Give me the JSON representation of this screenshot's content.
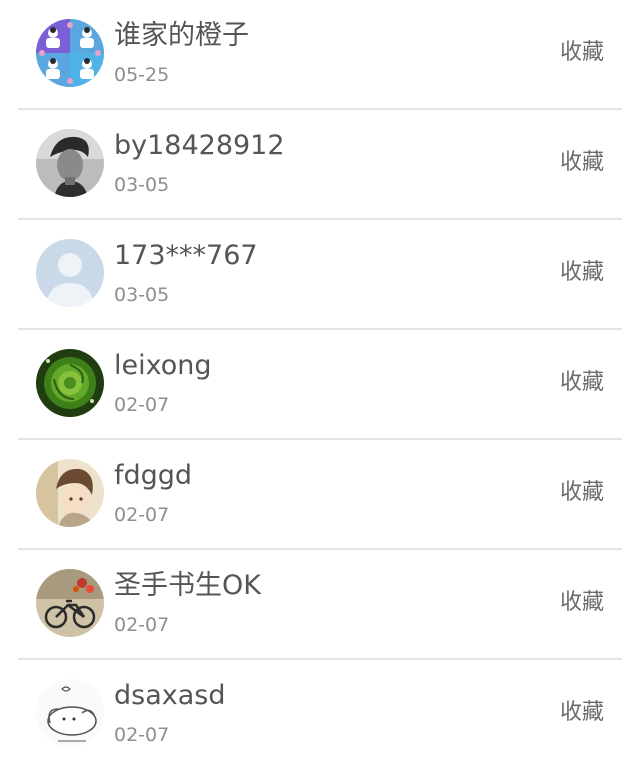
{
  "list": {
    "items": [
      {
        "name": "谁家的橙子",
        "date": "05-25",
        "action": "收藏",
        "avatar": "cartoon-figures-avatar-icon"
      },
      {
        "name": "by18428912",
        "date": "03-05",
        "action": "收藏",
        "avatar": "man-portrait-avatar-icon"
      },
      {
        "name": "173***767",
        "date": "03-05",
        "action": "收藏",
        "avatar": "default-user-avatar-icon"
      },
      {
        "name": "leixong",
        "date": "02-07",
        "action": "收藏",
        "avatar": "green-rose-avatar-icon"
      },
      {
        "name": "fdggd",
        "date": "02-07",
        "action": "收藏",
        "avatar": "anime-character-avatar-icon"
      },
      {
        "name": "圣手书生OK",
        "date": "02-07",
        "action": "收藏",
        "avatar": "bicycle-flowers-avatar-icon"
      },
      {
        "name": "dsaxasd",
        "date": "02-07",
        "action": "收藏",
        "avatar": "sketch-cartoon-avatar-icon"
      }
    ]
  },
  "colors": {
    "name_text": "#555555",
    "date_text": "#8e8e8e",
    "action_text": "#6b6b6b",
    "divider": "#e4e4e4",
    "background": "#ffffff"
  }
}
